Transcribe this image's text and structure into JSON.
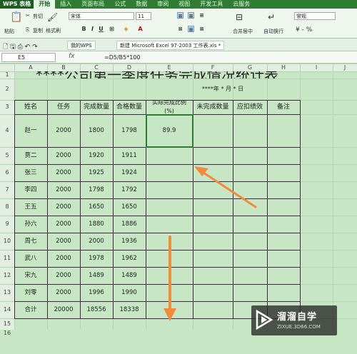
{
  "app": {
    "name": "WPS 表格",
    "tabs": [
      "开始",
      "插入",
      "页面布局",
      "公式",
      "数据",
      "审阅",
      "视图",
      "开发工具",
      "云服务"
    ],
    "active_tab": 0
  },
  "ribbon": {
    "paste": "粘贴",
    "cut": "剪切",
    "copy": "复制",
    "format_painter": "格式刷",
    "font_name": "宋体",
    "font_size": "11",
    "merge_center": "合并居中",
    "wrap": "自动换行",
    "number_format": "常规"
  },
  "doc_tabs": [
    "我的WPS",
    "新建 Microsoft Excel 97-2003 工作表.xls *"
  ],
  "formula_bar": {
    "cell_ref": "E5",
    "fx": "fx",
    "formula": "=D5/B5*100"
  },
  "columns": [
    "A",
    "B",
    "C",
    "D",
    "E",
    "F",
    "G",
    "H",
    "I",
    "J"
  ],
  "rows": [
    "1",
    "2",
    "3",
    "4",
    "5",
    "6",
    "7",
    "8",
    "9",
    "10",
    "11",
    "12",
    "13",
    "14",
    "15",
    "16"
  ],
  "sheet": {
    "title": "****公司第一季度任务完成情况统计表",
    "date_line": "****年 *  月   * 日",
    "headers": [
      "姓名",
      "任务",
      "完成数量",
      "合格数量",
      "实际完成比例\n(%)",
      "未完成数量",
      "应扣绩效",
      "备注"
    ],
    "data": [
      [
        "赵一",
        "2000",
        "1800",
        "1798",
        "89.9",
        "",
        "",
        ""
      ],
      [
        "贾二",
        "2000",
        "1920",
        "1911",
        "",
        "",
        "",
        ""
      ],
      [
        "张三",
        "2000",
        "1925",
        "1924",
        "",
        "",
        "",
        ""
      ],
      [
        "李四",
        "2000",
        "1798",
        "1792",
        "",
        "",
        "",
        ""
      ],
      [
        "王五",
        "2000",
        "1650",
        "1650",
        "",
        "",
        "",
        ""
      ],
      [
        "孙六",
        "2000",
        "1880",
        "1886",
        "",
        "",
        "",
        ""
      ],
      [
        "周七",
        "2000",
        "2000",
        "1936",
        "",
        "",
        "",
        ""
      ],
      [
        "武八",
        "2000",
        "1978",
        "1962",
        "",
        "",
        "",
        ""
      ],
      [
        "宋九",
        "2000",
        "1489",
        "1489",
        "",
        "",
        "",
        ""
      ],
      [
        "刘零",
        "2000",
        "1996",
        "1990",
        "",
        "",
        "",
        ""
      ],
      [
        "合计",
        "20000",
        "18556",
        "18338",
        "",
        "",
        "",
        ""
      ]
    ]
  },
  "watermark": {
    "title": "溜溜自学",
    "url": "ZIXUE.3D66.COM"
  },
  "colors": {
    "selection": "#2e7d32",
    "arrow": "#f08a3c",
    "grid_bg": "#c7e6c4"
  }
}
